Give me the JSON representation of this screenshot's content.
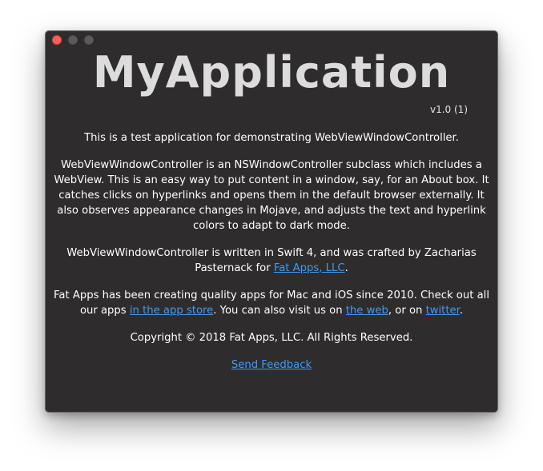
{
  "window": {
    "title": "MyApplication",
    "version": "v1.0 (1)"
  },
  "content": {
    "intro": "This is a test application for demonstrating WebViewWindowController.",
    "description": "WebViewWindowController is an NSWindowController subclass which includes a WebView. This is an easy way to put content in a window, say, for an About box. It catches clicks on hyperlinks and opens them in the default browser externally. It also observes appearance changes in Mojave, and adjusts the text and hyperlink colors to adapt to dark mode.",
    "credits_prefix": "WebViewWindowController is written in Swift 4, and was crafted by Zacharias Pasternack for ",
    "credits_link": "Fat Apps, LLC",
    "credits_suffix": ".",
    "about_prefix": "Fat Apps has been creating quality apps for Mac and iOS since 2010. Check out all our apps ",
    "about_app_store_link": "in the app store",
    "about_middle": ". You can also visit us on ",
    "about_web_link": "the web",
    "about_or": ", or on ",
    "about_twitter_link": "twitter",
    "about_suffix": ".",
    "copyright": "Copyright © 2018 Fat Apps, LLC. All Rights Reserved.",
    "feedback_link": "Send Feedback"
  },
  "colors": {
    "background": "#2e2c2c",
    "text": "#ffffff",
    "link": "#3f9bf5",
    "title": "#dcdcdc",
    "close_button": "#ff5f57"
  }
}
